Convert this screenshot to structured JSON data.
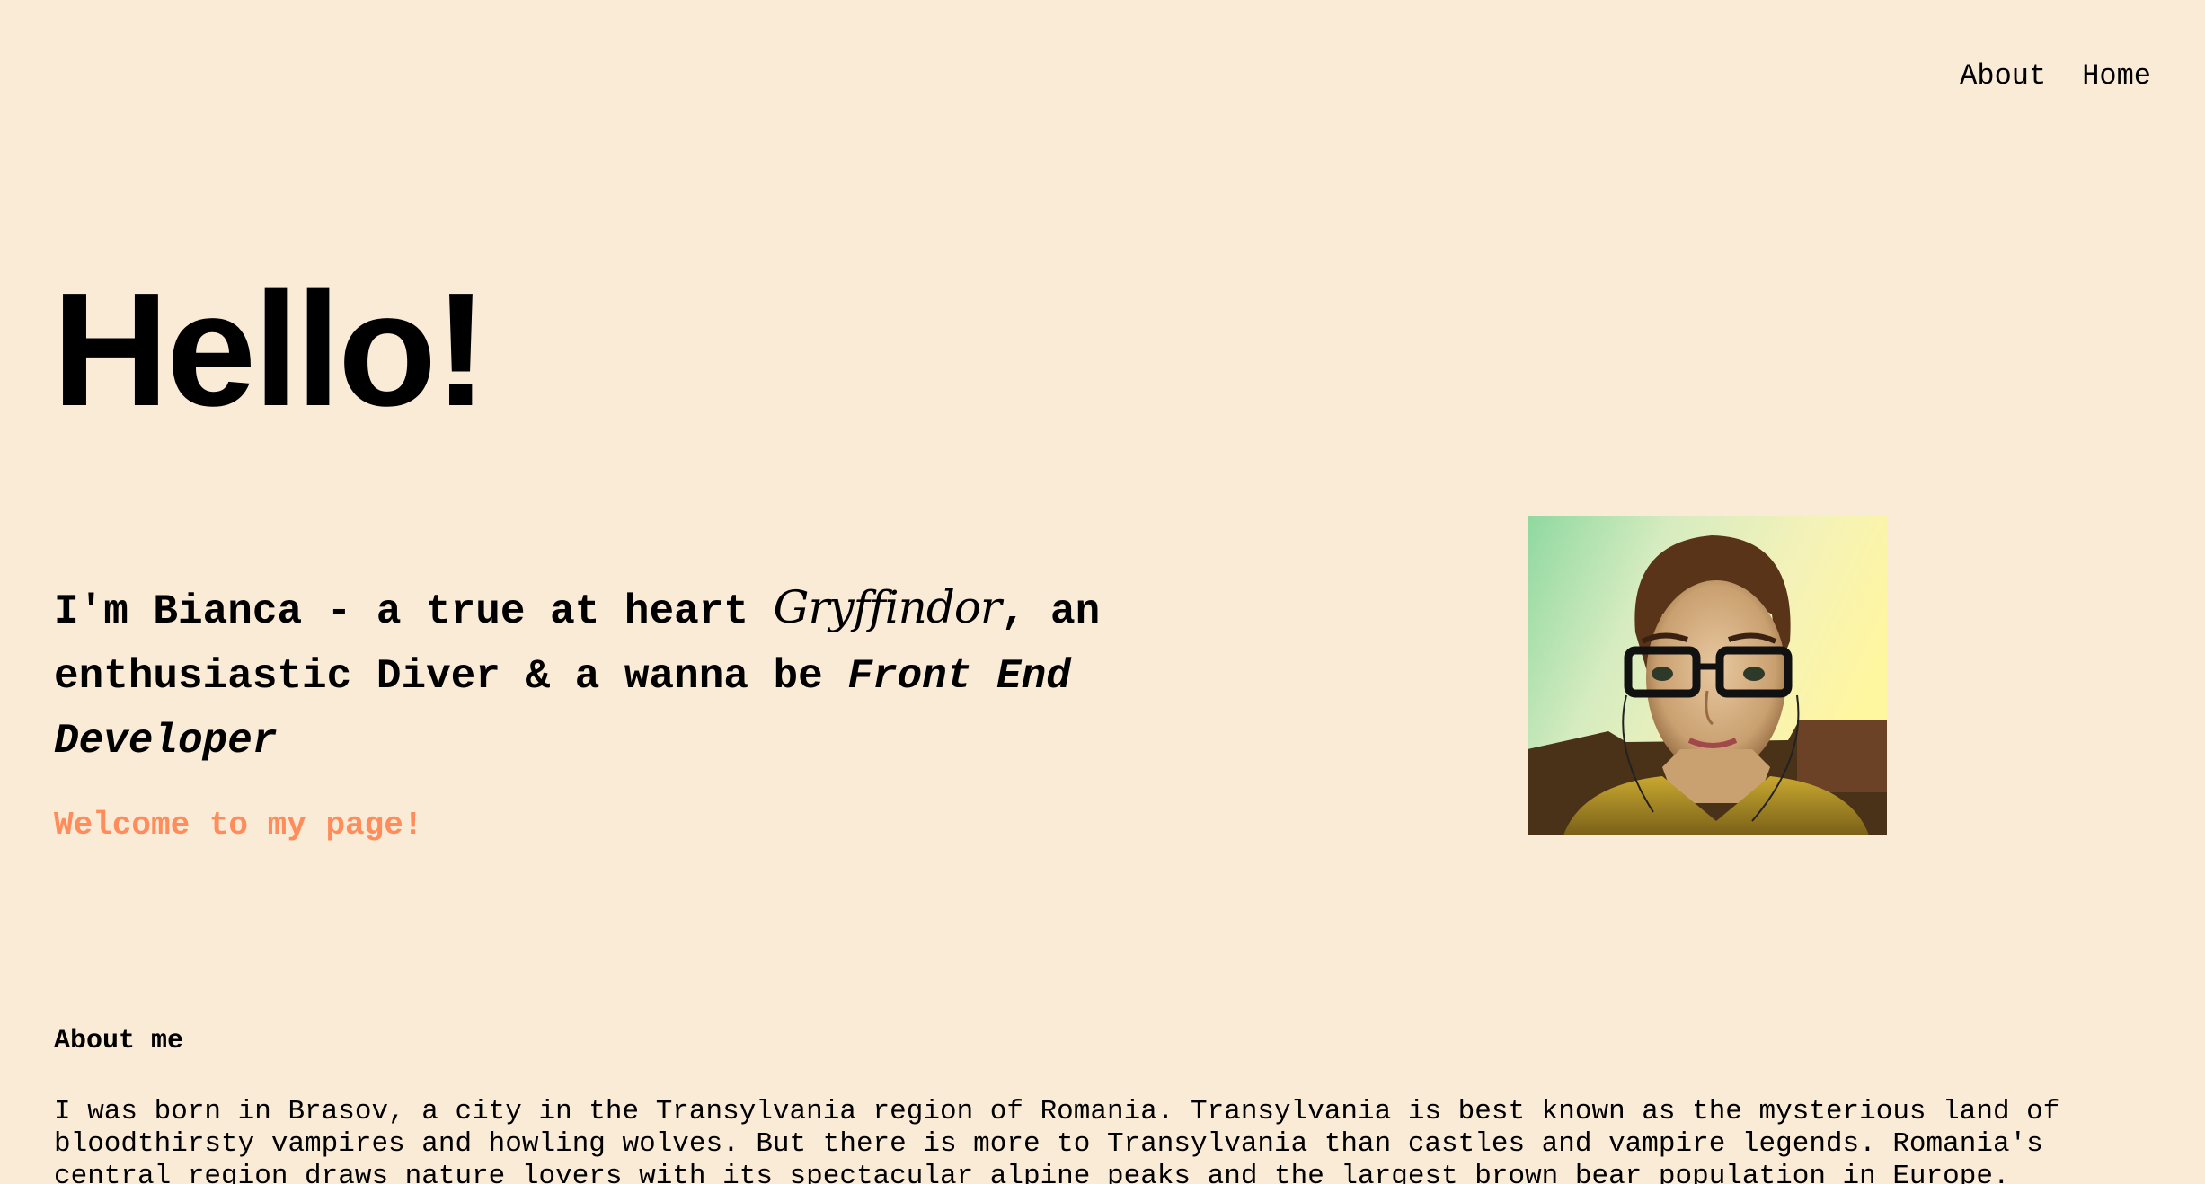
{
  "nav": {
    "about_label": "About",
    "home_label": "Home"
  },
  "hero": {
    "title": "Hello!"
  },
  "intro": {
    "part1": "I'm Bianca - a true at heart ",
    "house": "Gryffindor",
    "part2": ", an enthusiastic Diver & a wanna be ",
    "role": "Front End Developer"
  },
  "welcome": "Welcome to my page!",
  "photo": {
    "alt": "Bianca"
  },
  "about": {
    "heading": "About me",
    "text": "I was born in Brasov, a city in the Transylvania region of Romania. Transylvania is best known as the mysterious land of bloodthirsty vampires and howling wolves. But there is more to Transylvania than castles and vampire legends. Romania's central region draws nature lovers with its spectacular alpine peaks and the largest brown bear population in Europe."
  },
  "colors": {
    "background": "#faebd7",
    "accent": "#ff8c5a",
    "text": "#000000"
  }
}
